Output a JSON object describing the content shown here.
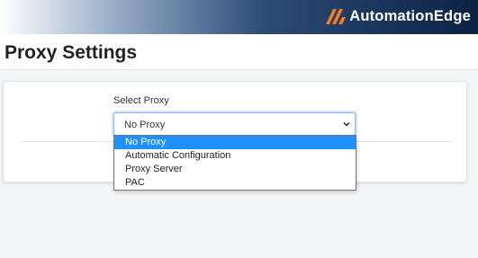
{
  "header": {
    "brand_name": "AutomationEdge",
    "brand_icon": "automationedge-logo-icon",
    "accent_color": "#f07d1e"
  },
  "page": {
    "title": "Proxy Settings"
  },
  "proxy": {
    "label": "Select Proxy",
    "selected": "No Proxy",
    "options": [
      "No Proxy",
      "Automatic Configuration",
      "Proxy Server",
      "PAC"
    ]
  }
}
